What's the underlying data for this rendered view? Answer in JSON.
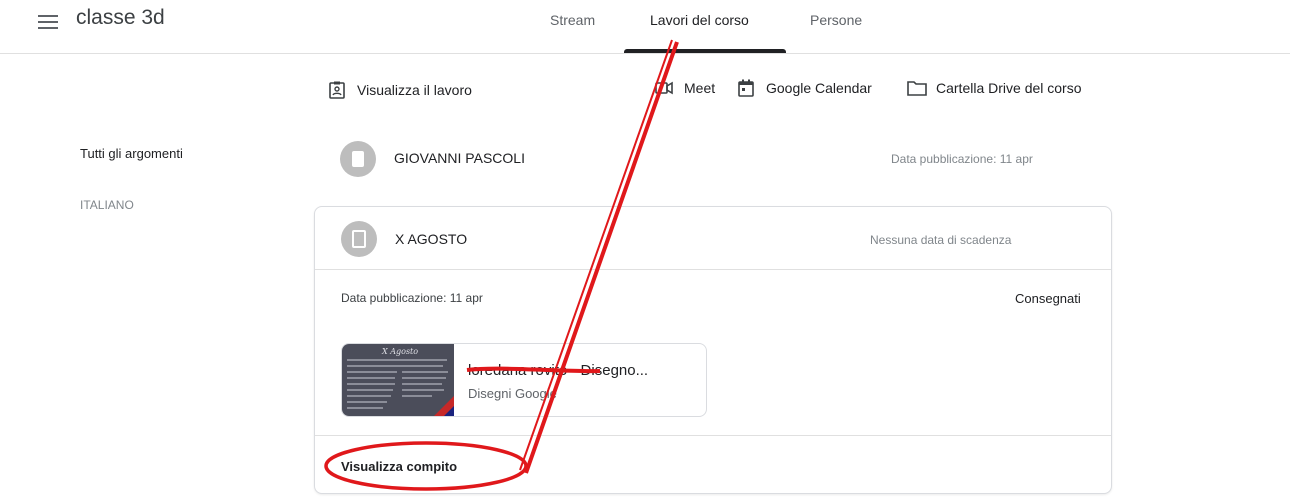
{
  "header": {
    "class_name": "classe 3d",
    "tabs": [
      {
        "label": "Stream",
        "active": false
      },
      {
        "label": "Lavori del corso",
        "active": true
      },
      {
        "label": "Persone",
        "active": false
      }
    ]
  },
  "actions": {
    "view_work": "Visualizza il lavoro",
    "meet": "Meet",
    "calendar": "Google Calendar",
    "drive": "Cartella Drive del corso"
  },
  "sidebar": {
    "items": [
      "Tutti gli argomenti",
      "ITALIANO"
    ]
  },
  "topics": [
    {
      "title": "GIOVANNI PASCOLI",
      "meta": "Data pubblicazione: 11 apr",
      "icon": "material-icon"
    },
    {
      "title": "X AGOSTO",
      "meta": "Nessuna data di scadenza",
      "icon": "assignment-icon"
    }
  ],
  "assignment_detail": {
    "posted": "Data pubblicazione: 11 apr",
    "status": "Consegnati",
    "attachment": {
      "title": "loredana rovito - Disegno...",
      "type": "Disegni Google",
      "thumb_title": "X Agosto"
    },
    "view_link": "Visualizza compito"
  },
  "annotation_color": "#e0181b"
}
